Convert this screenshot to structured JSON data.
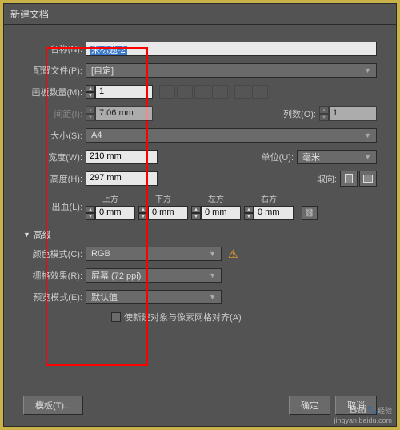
{
  "title": "新建文档",
  "fields": {
    "name_label": "名称(N):",
    "name_value": "未标题-2",
    "profile_label": "配置文件(P):",
    "profile_value": "[自定]",
    "artboards_label": "画板数量(M):",
    "artboards_value": "1",
    "spacing_label": "间距(I):",
    "spacing_value": "7.06 mm",
    "columns_label": "列数(O):",
    "columns_value": "1",
    "size_label": "大小(S):",
    "size_value": "A4",
    "width_label": "宽度(W):",
    "width_value": "210 mm",
    "units_label": "单位(U):",
    "units_value": "毫米",
    "height_label": "高度(H):",
    "height_value": "297 mm",
    "orient_label": "取向:",
    "bleed_label": "出血(L):",
    "bleed_top": "上方",
    "bleed_bottom": "下方",
    "bleed_left": "左方",
    "bleed_right": "右方",
    "bleed_value": "0 mm"
  },
  "advanced": {
    "header": "高级",
    "colormode_label": "颜色模式(C):",
    "colormode_value": "RGB",
    "raster_label": "栅格效果(R):",
    "raster_value": "屏幕 (72 ppi)",
    "preview_label": "预览模式(E):",
    "preview_value": "默认值",
    "align_label": "使新建对象与像素网格对齐(A)"
  },
  "buttons": {
    "template": "模板(T)...",
    "ok": "确定",
    "cancel": "取消"
  },
  "watermark": {
    "logo": "Bai",
    "logo2": "经验",
    "url": "jingyan.baidu.com"
  }
}
